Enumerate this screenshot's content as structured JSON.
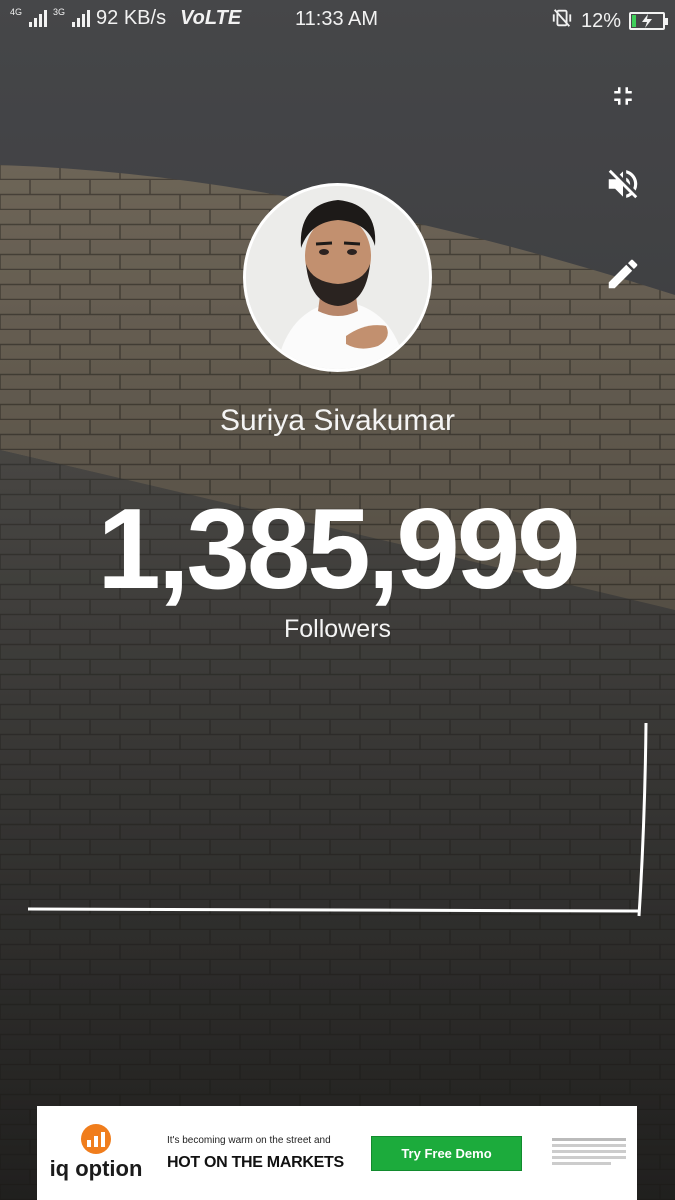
{
  "status_bar": {
    "net_4g": "4G",
    "net_3g": "3G",
    "speed": "92 KB/s",
    "volte": "VoLTE",
    "time": "11:33 AM",
    "battery_percent": "12%",
    "battery_level": 0.12,
    "battery_color": "#3fcf5a"
  },
  "actions": {
    "minimize_icon": "fullscreen-exit-icon",
    "mute_icon": "volume-off-icon",
    "edit_icon": "pencil-icon"
  },
  "profile": {
    "name": "Suriya Sivakumar",
    "followers_count": "1,385,999",
    "followers_label": "Followers"
  },
  "ad": {
    "brand": "iq option",
    "tagline": "It's becoming warm on the street and",
    "headline": "HOT ON THE MARKETS",
    "cta": "Try Free Demo",
    "brand_color": "#f07d1c",
    "cta_color": "#1cab3c"
  }
}
